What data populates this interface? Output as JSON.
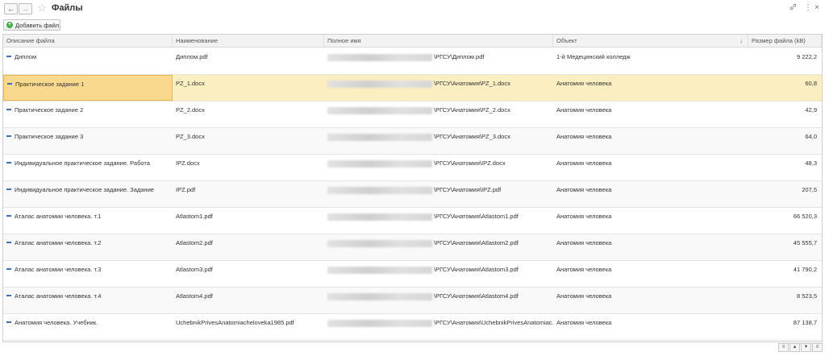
{
  "window": {
    "title": "Файлы",
    "back_glyph": "←",
    "forward_glyph": "→",
    "favorite_glyph": "☆",
    "link_glyph": "🔗",
    "more_glyph": "⋮",
    "close_glyph": "×"
  },
  "toolbar": {
    "add_file_label": "Добавить файл",
    "add_icon": "+"
  },
  "columns": {
    "description": "Описание файла",
    "name": "Наименование",
    "full_path": "Полное имя",
    "object": "Объект",
    "size": "Размер файла (kB)",
    "sort_glyph": "↓"
  },
  "rows": [
    {
      "description": "Диплом",
      "name": "Диплом.pdf",
      "path_suffix": "\\РГСУ\\Диплом.pdf",
      "object": "1-й Медецинский колледж",
      "size": "9 222,2"
    },
    {
      "description": "Практическое задание 1",
      "name": "PZ_1.docx",
      "path_suffix": "\\РГСУ\\Анатомия\\PZ_1.docx",
      "object": "Анатомия человека",
      "size": "60,8"
    },
    {
      "description": "Практическое задание 2",
      "name": "PZ_2.docx",
      "path_suffix": "\\РГСУ\\Анатомия\\PZ_2.docx",
      "object": "Анатомия человека",
      "size": "42,9"
    },
    {
      "description": "Практическое задание 3",
      "name": "PZ_3.docx",
      "path_suffix": "\\РГСУ\\Анатомия\\PZ_3.docx",
      "object": "Анатомия человека",
      "size": "64,0"
    },
    {
      "description": "Индивидуальное практическое задание. Работа",
      "name": "IPZ.docx",
      "path_suffix": "\\РГСУ\\Анатомия\\IPZ.docx",
      "object": "Анатомия человека",
      "size": "48,3"
    },
    {
      "description": "Индивидуальное практическое задание. Задание",
      "name": "IPZ.pdf",
      "path_suffix": "\\РГСУ\\Анатомия\\IPZ.pdf",
      "object": "Анатомия человека",
      "size": "207,5"
    },
    {
      "description": "Аталас анатомии человека. т.1",
      "name": "Atlastom1.pdf",
      "path_suffix": "\\РГСУ\\Анатомия\\Atlastom1.pdf",
      "object": "Анатомия человека",
      "size": "66 520,3"
    },
    {
      "description": "Аталас анатомии человека. т.2",
      "name": "Atlastom2.pdf",
      "path_suffix": "\\РГСУ\\Анатомия\\Atlastom2.pdf",
      "object": "Анатомия человека",
      "size": "45 555,7"
    },
    {
      "description": "Аталас анатомии человека. т.3",
      "name": "Atlastom3.pdf",
      "path_suffix": "\\РГСУ\\Анатомия\\Atlastom3.pdf",
      "object": "Анатомия человека",
      "size": "41 790,2"
    },
    {
      "description": "Аталас анатомии человека. т.4",
      "name": "Atlastom4.pdf",
      "path_suffix": "\\РГСУ\\Анатомия\\Atlastom4.pdf",
      "object": "Анатомия человека",
      "size": "8 523,5"
    },
    {
      "description": "Анатомия человека. Учебник.",
      "name": "UchebnikPrivesAnatomiacheloveka1985.pdf",
      "path_suffix": "\\РГСУ\\Анатомия\\UchebnikPrivesAnatomiac...",
      "object": "Анатомия человека",
      "size": "87 138,7"
    }
  ],
  "footer": {
    "buttons": [
      "≡",
      "▲",
      "▼",
      "≡"
    ]
  },
  "colors": {
    "selected_row": "#fbeec1",
    "focused_cell": "#f9d98d",
    "add_icon": "#3fae49",
    "row_marker": "#3d6fb8"
  }
}
